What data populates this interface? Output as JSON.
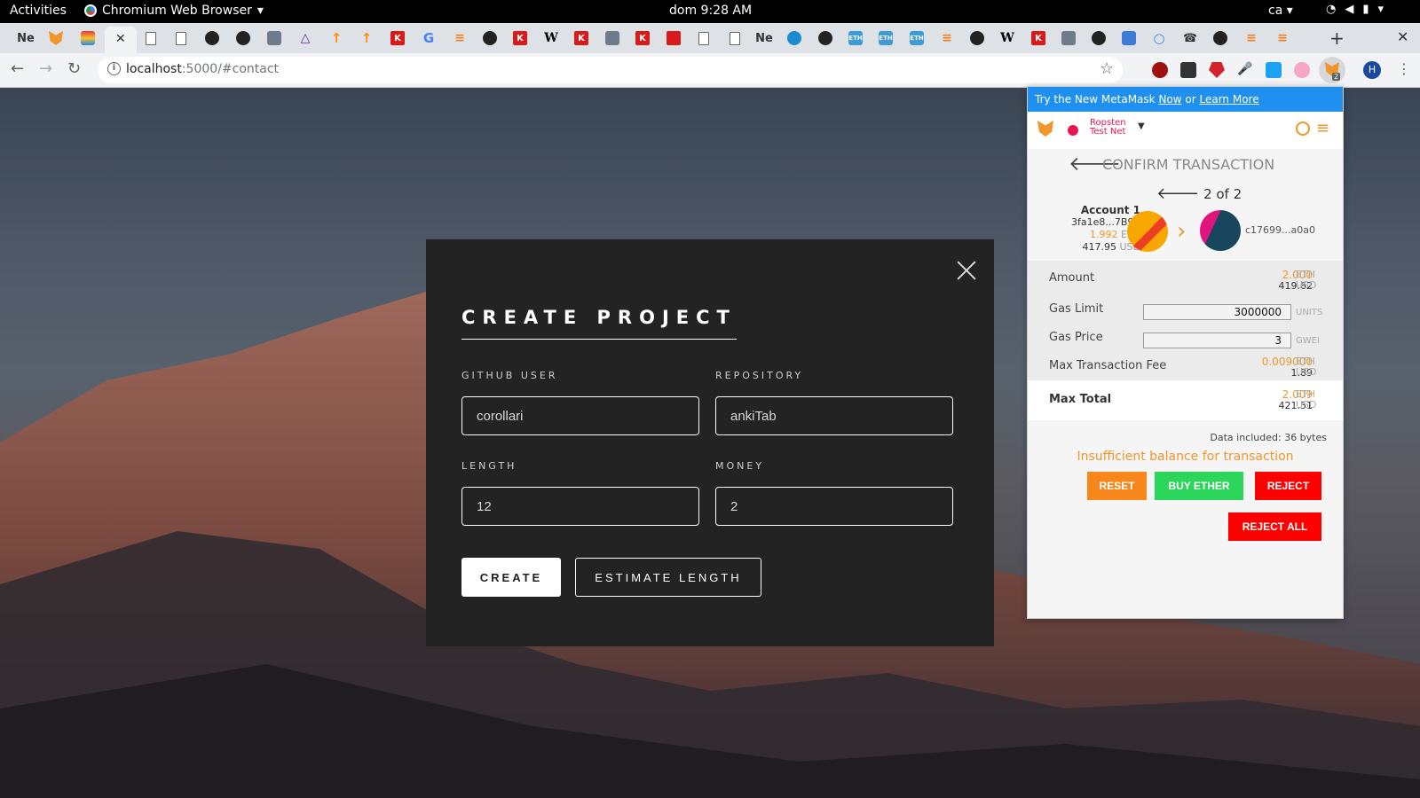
{
  "os_bar": {
    "activities": "Activities",
    "app_name": "Chromium Web Browser",
    "clock": "dom  9:28 AM",
    "keyboard_layout": "ca"
  },
  "tabs": {
    "first_tab_label": "Ne",
    "other_ne_label": "Ne",
    "k_label": "K",
    "w_label": "W",
    "g_label": "G",
    "eth_label": "ETH",
    "new_tab": "+",
    "close": "✕"
  },
  "toolbar": {
    "url_host": "localhost",
    "url_rest": ":5000/#contact",
    "profile_initial": "H",
    "extension_badge": "2"
  },
  "modal": {
    "title": "CREATE PROJECT",
    "fields": {
      "github_user": {
        "label": "GITHUB USER",
        "value": "corollari"
      },
      "repository": {
        "label": "REPOSITORY",
        "value": "ankiTab"
      },
      "length": {
        "label": "LENGTH",
        "value": "12"
      },
      "money": {
        "label": "MONEY",
        "value": "2"
      }
    },
    "create_button": "CREATE",
    "estimate_button": "ESTIMATE LENGTH"
  },
  "metamask": {
    "banner_prefix": "Try the New MetaMask ",
    "banner_now": "Now",
    "banner_or": " or ",
    "banner_learn": "Learn More",
    "network_line1": "Ropsten",
    "network_line2": "Test Net",
    "title": "CONFIRM TRANSACTION",
    "counter": "2 of 2",
    "account_name": "Account 1",
    "account_address": "3fa1e8...7B9B",
    "account_eth": "1.992",
    "account_eth_unit": "ETH",
    "account_usd": "417.95",
    "account_usd_unit": "USD",
    "to_address": "c17699...a0a0",
    "amount_label": "Amount",
    "amount_eth": "2.000",
    "amount_usd": "419.62",
    "gas_limit_label": "Gas Limit",
    "gas_limit_value": "3000000",
    "gas_limit_unit": "UNITS",
    "gas_price_label": "Gas Price",
    "gas_price_value": "3",
    "gas_price_unit": "GWEI",
    "max_fee_label": "Max Transaction Fee",
    "max_fee_eth": "0.009000",
    "max_fee_usd": "1.89",
    "max_total_label": "Max Total",
    "max_total_eth": "2.009",
    "max_total_usd": "421.51",
    "eth_unit": "ETH",
    "usd_unit": "USD",
    "data_included": "Data included: 36 bytes",
    "error": "Insufficient balance for transaction",
    "buttons": {
      "reset": "RESET",
      "buy_ether": "BUY ETHER",
      "reject": "REJECT",
      "reject_all": "REJECT ALL"
    }
  },
  "colors": {
    "metamask_orange": "#f0962c",
    "reject_red": "#ff0000",
    "buy_green": "#2bd65a",
    "banner_blue": "#1f8ff0",
    "modal_bg": "#232323"
  }
}
